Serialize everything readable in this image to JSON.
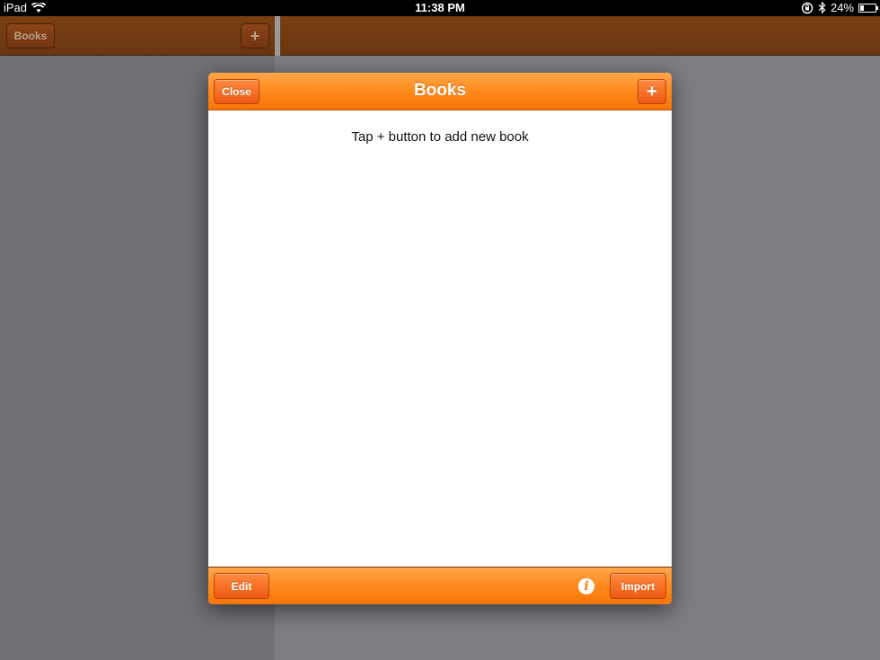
{
  "status_bar": {
    "device": "iPad",
    "time": "11:38 PM",
    "battery_percent": "24%",
    "battery_level": 0.24,
    "icons": [
      "wifi-icon",
      "rotation-lock-icon",
      "bluetooth-icon",
      "battery-icon"
    ]
  },
  "master": {
    "nav_button_label": "Books",
    "add_label": "+"
  },
  "modal": {
    "title": "Books",
    "close_label": "Close",
    "add_label": "+",
    "empty_message": "Tap + button to add new book",
    "edit_label": "Edit",
    "info_label": "i",
    "import_label": "Import"
  },
  "colors": {
    "accent_orange": "#ff8a1c",
    "button_orange": "#f06018",
    "dim_nav_brown": "#7a3f12"
  }
}
